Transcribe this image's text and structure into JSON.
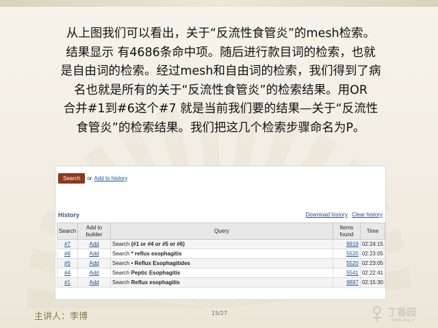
{
  "paragraph": {
    "line1": "从上图我们可以看出，关于“反流性食管炎”的mesh检索。",
    "line2": "结果显示 有4686条命中项。随后进行款目词的检索，也就",
    "line3": "是自由词的检索。经过mesh和自由词的检索，我们得到了病",
    "line4": "名也就是所有的关于“反流性食管炎”的检索结果。用OR",
    "line5": "合并#1到#6这个#7 就是当前我们要的结果—关于“反流性",
    "line6": "食管炎”的检索结果。我们把这几个检索步骤命名为P。"
  },
  "search_bar": {
    "search_label": "Search",
    "or_text": "or",
    "add_history_link": "Add to history"
  },
  "history": {
    "title": "History",
    "download_link": "Download history",
    "clear_link": "Clear history",
    "columns": {
      "search": "Search",
      "add_to_builder": "Add to builder",
      "query": "Query",
      "items_found": "Items found",
      "time": "Time"
    },
    "rows": [
      {
        "id": "#7",
        "add": "Add",
        "prefix": "Search",
        "query": "(#1 or #4 or #5 or #6)",
        "items": "9919",
        "time": "02:24:15"
      },
      {
        "id": "#6",
        "add": "Add",
        "prefix": "Search",
        "query": "* reflux esophagitis",
        "items": "5520",
        "time": "02:23:05"
      },
      {
        "id": "#5",
        "add": "Add",
        "prefix": "Search",
        "query": "• Reflux Esophagitides",
        "items": "5520",
        "time": "02:23:05"
      },
      {
        "id": "#4",
        "add": "Add",
        "prefix": "Search",
        "query": "Peptic Esophagitis",
        "items": "5541",
        "time": "02:22:41"
      },
      {
        "id": "#1",
        "add": "Add",
        "prefix": "Search",
        "query": "Reflux esophagitis",
        "items": "9897",
        "time": "02:15:30"
      }
    ]
  },
  "footer": {
    "presenter": "主讲人：李博",
    "page": "15/27"
  },
  "watermark": {
    "name": "丁香园",
    "url": "www.dxy.cn"
  }
}
